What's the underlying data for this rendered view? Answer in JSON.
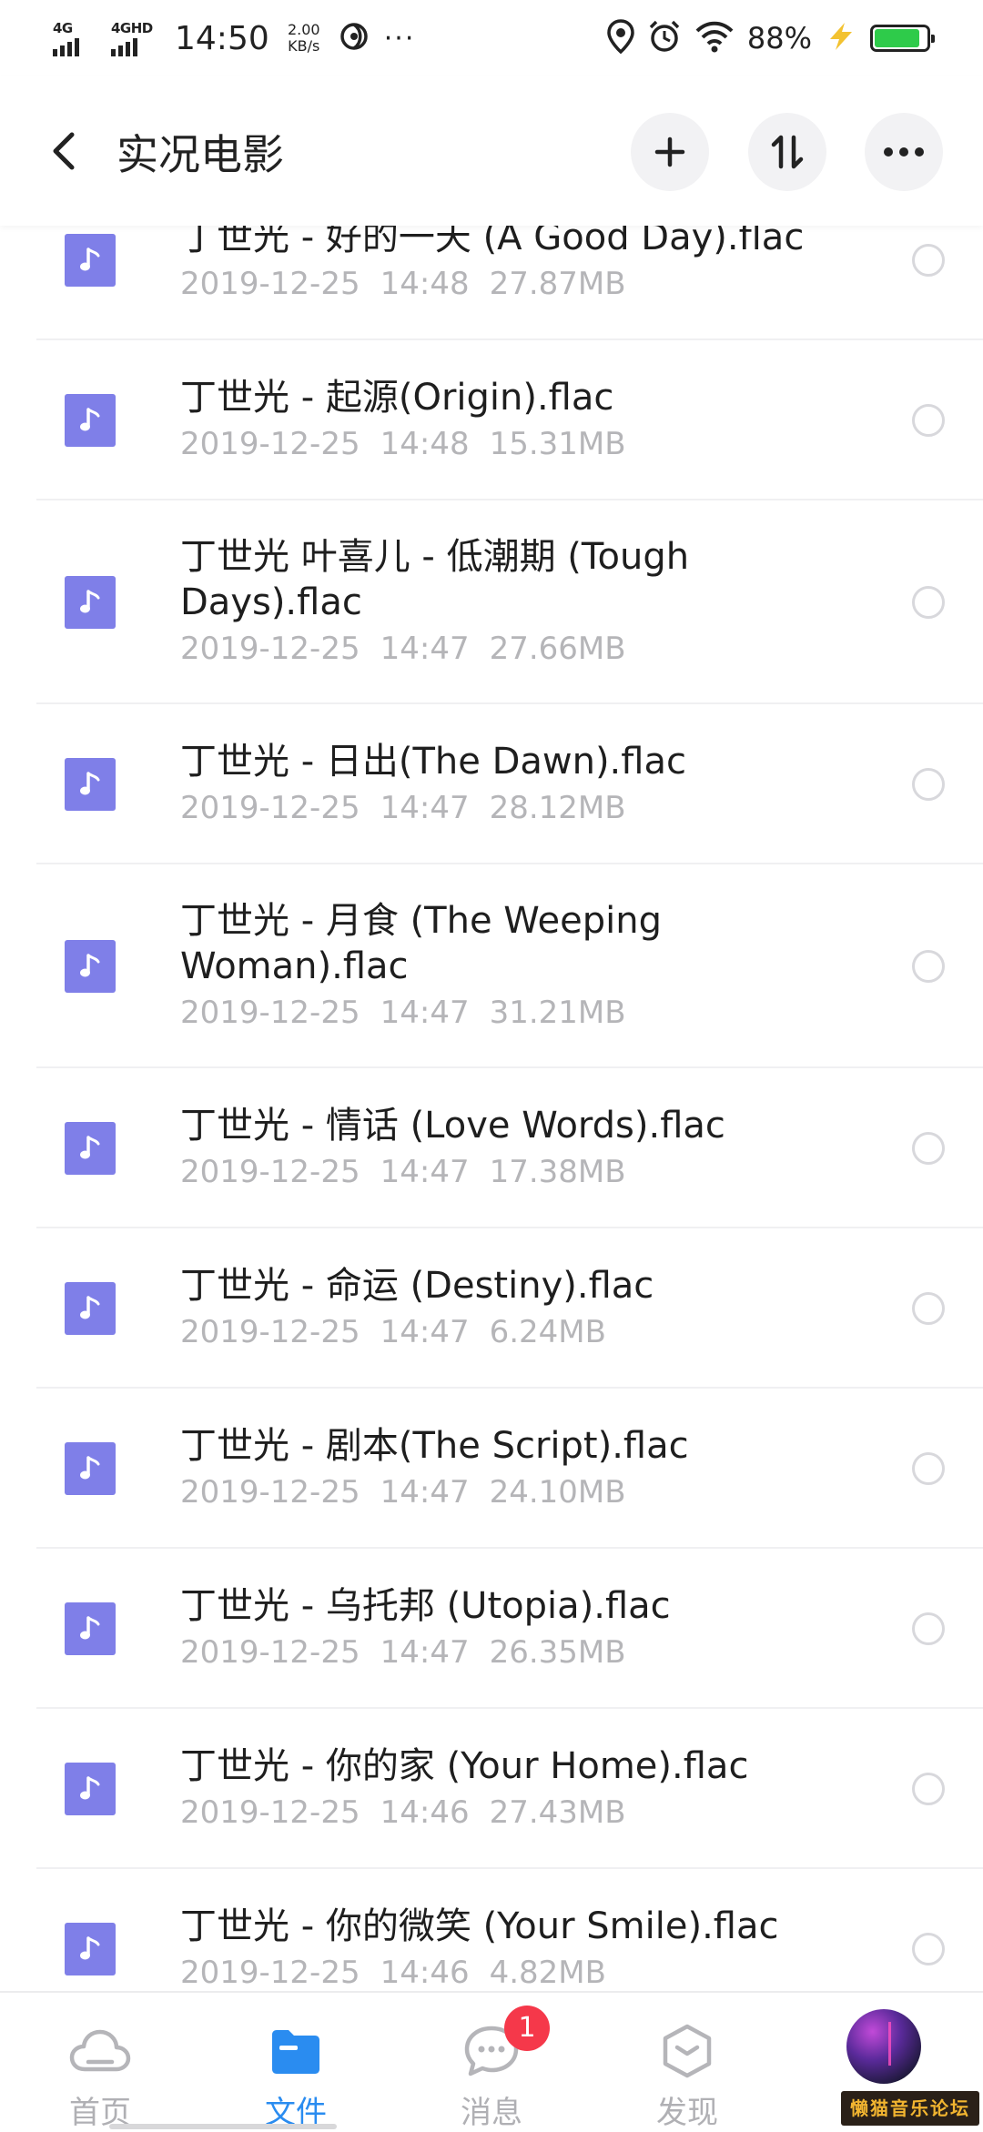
{
  "status_bar": {
    "signal_1": "4G",
    "signal_2": "4GHD",
    "time": "14:50",
    "speed_value": "2.00",
    "speed_unit": "KB/s",
    "more": "···",
    "battery_text": "88%",
    "battery_level": 0.88,
    "battery_color": "#2ecb4a"
  },
  "header": {
    "title": "实况电影",
    "icons": [
      "back-icon",
      "add-icon",
      "sort-icon",
      "more-icon"
    ]
  },
  "files": [
    {
      "name": "丁世光 - 好的一天 (A Good Day).flac",
      "date": "2019-12-25",
      "time": "14:48",
      "size": "27.87MB"
    },
    {
      "name": "丁世光 - 起源(Origin).flac",
      "date": "2019-12-25",
      "time": "14:48",
      "size": "15.31MB"
    },
    {
      "name": "丁世光 叶喜儿 - 低潮期 (Tough Days).flac",
      "date": "2019-12-25",
      "time": "14:47",
      "size": "27.66MB"
    },
    {
      "name": "丁世光 - 日出(The Dawn).flac",
      "date": "2019-12-25",
      "time": "14:47",
      "size": "28.12MB"
    },
    {
      "name": "丁世光 - 月食 (The Weeping Woman).flac",
      "date": "2019-12-25",
      "time": "14:47",
      "size": "31.21MB"
    },
    {
      "name": "丁世光 - 情话 (Love Words).flac",
      "date": "2019-12-25",
      "time": "14:47",
      "size": "17.38MB"
    },
    {
      "name": "丁世光 - 命运 (Destiny).flac",
      "date": "2019-12-25",
      "time": "14:47",
      "size": "6.24MB"
    },
    {
      "name": "丁世光 - 剧本(The Script).flac",
      "date": "2019-12-25",
      "time": "14:47",
      "size": "24.10MB"
    },
    {
      "name": "丁世光 - 乌托邦 (Utopia).flac",
      "date": "2019-12-25",
      "time": "14:47",
      "size": "26.35MB"
    },
    {
      "name": "丁世光 - 你的家 (Your Home).flac",
      "date": "2019-12-25",
      "time": "14:46",
      "size": "27.43MB"
    },
    {
      "name": "丁世光 - 你的微笑 (Your Smile).flac",
      "date": "2019-12-25",
      "time": "14:46",
      "size": "4.82MB"
    }
  ],
  "bottom_nav": {
    "home": "首页",
    "files": "文件",
    "messages": "消息",
    "messages_badge": "1",
    "discover": "发现",
    "accent": "#2a8cf0"
  },
  "watermark": "懒猫音乐论坛"
}
